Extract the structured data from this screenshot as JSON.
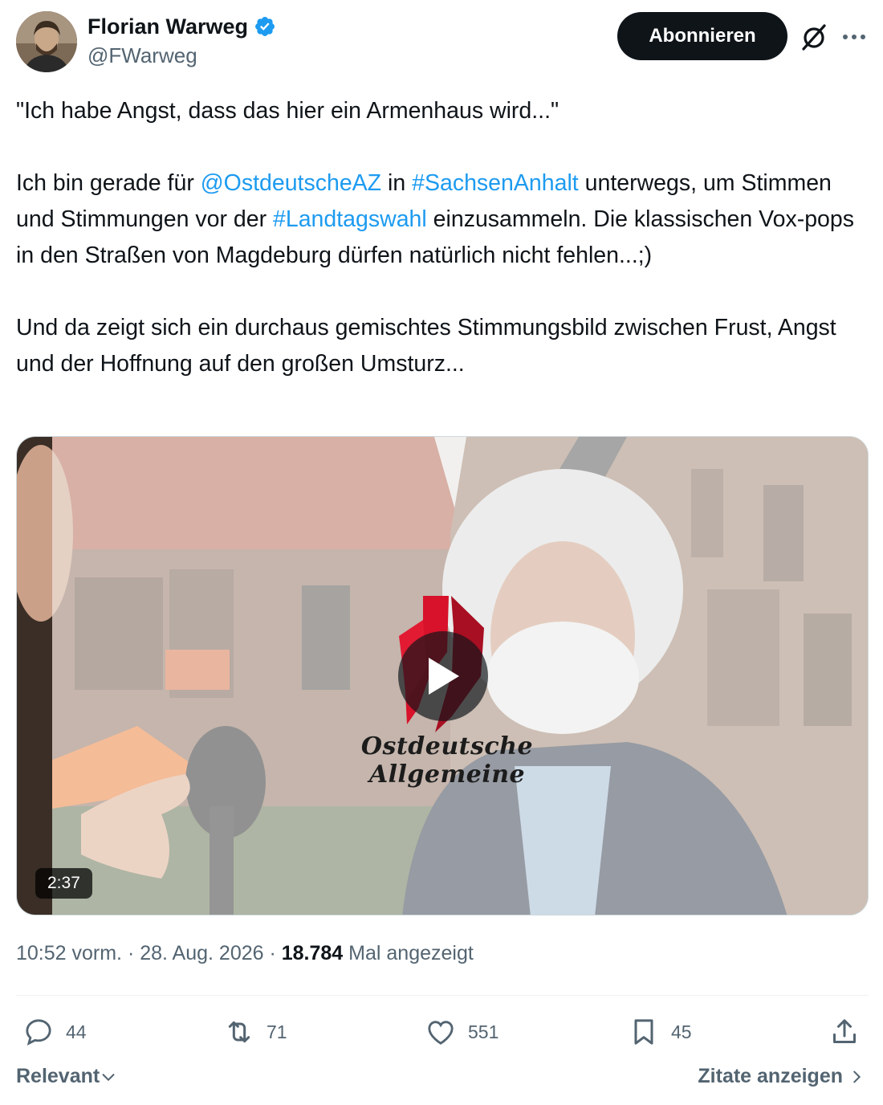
{
  "author": {
    "display_name": "Florian Warweg",
    "handle": "@FWarweg",
    "verified": true
  },
  "follow_label": "Abonnieren",
  "tweet": {
    "line1": "\"Ich habe Angst, dass das hier ein Armenhaus wird...\"",
    "p2_a": "Ich bin gerade für ",
    "mention": "@OstdeutscheAZ",
    "p2_b": "  in ",
    "hashtag1": "#SachsenAnhalt",
    "p2_c": " unterwegs, um Stimmen und Stimmungen vor der ",
    "hashtag2": "#Landtagswahl",
    "p2_d": " einzusammeln. Die klassischen Vox-pops in den Straßen von Magdeburg dürfen natürlich nicht fehlen...;)",
    "p3": "Und da zeigt sich ein durchaus gemischtes Stimmungsbild zwischen Frust, Angst und der Hoffnung auf den großen Umsturz..."
  },
  "video": {
    "logo_text": "Ostdeutsche Allgemeine",
    "duration": "2:37"
  },
  "meta": {
    "time_date": "10:52 vorm. · 28. Aug. 2026 · ",
    "views": "18.784",
    "views_label": " Mal angezeigt"
  },
  "actions": {
    "replies": "44",
    "reposts": "71",
    "likes": "551",
    "bookmarks": "45"
  },
  "footer": {
    "sort_label": "Relevant",
    "quotes_label": "Zitate anzeigen"
  },
  "colors": {
    "link": "#1d9bf0",
    "secondary_text": "#536471",
    "primary_text": "#0f1419",
    "logo_red": "#d7122a"
  },
  "icons": [
    "verified-badge-icon",
    "grok-icon",
    "more-icon",
    "play-icon",
    "reply-icon",
    "repost-icon",
    "like-icon",
    "bookmark-icon",
    "share-icon",
    "chevron-down-icon",
    "chevron-right-icon"
  ]
}
